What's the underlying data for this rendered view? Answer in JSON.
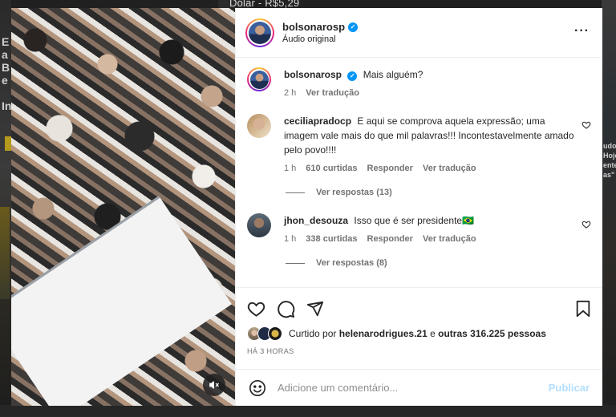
{
  "background": {
    "ticker": "Dólar - R$5,29",
    "left_glyphs": "E\na\nB\ne\n\nIn",
    "side_snippet": "udo\nHoje\nente\nas\""
  },
  "post": {
    "author": "bolsonarosp",
    "audio_label": "Áudio original",
    "caption_text": "Mais alguém?",
    "caption_age": "2 h",
    "caption_translate": "Ver tradução"
  },
  "comments": [
    {
      "user": "ceciliapradocp",
      "text": "E aqui se comprova aquela expressão; uma imagem vale mais do que mil palavras!!! Incontestavelmente amado pelo povo!!!!",
      "age": "1 h",
      "likes": "610 curtidas",
      "reply": "Responder",
      "translate": "Ver tradução",
      "view_replies": "Ver respostas (13)"
    },
    {
      "user": "jhon_desouza",
      "text": "Isso que é ser presidente🇧🇷",
      "age": "1 h",
      "likes": "338 curtidas",
      "reply": "Responder",
      "translate": "Ver tradução",
      "view_replies": "Ver respostas (8)"
    }
  ],
  "likes_bar": {
    "prefix": "Curtido por",
    "user": "helenarodrigues.21",
    "connector": "e",
    "others": "outras 316.225 pessoas"
  },
  "timestamp": "HÁ 3 HORAS",
  "composer": {
    "placeholder": "Adicione um comentário...",
    "publish_label": "Publicar"
  },
  "icons": {
    "verified": "verified-badge-icon",
    "more": "more-options-icon",
    "like": "heart-icon",
    "comment": "comment-bubble-icon",
    "share": "paper-plane-icon",
    "save": "bookmark-icon",
    "emoji": "emoji-icon",
    "mute": "muted-speaker-icon"
  },
  "colors": {
    "verified": "#0095f6",
    "muted_text": "#737373",
    "publish_disabled": "#b2dffc"
  }
}
